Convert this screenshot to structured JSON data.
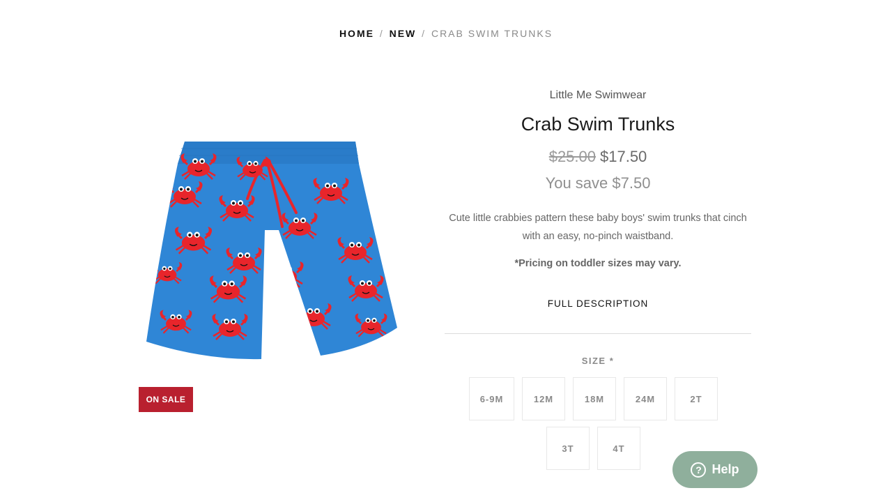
{
  "breadcrumb": {
    "home": "HOME",
    "new": "NEW",
    "current": "CRAB SWIM TRUNKS",
    "separator": "/"
  },
  "product": {
    "vendor": "Little Me Swimwear",
    "title": "Crab Swim Trunks",
    "compare_price": "$25.00",
    "price": "$17.50",
    "savings": "You save $7.50",
    "description": "Cute little crabbies pattern these baby boys' swim trunks that cinch with an easy, no-pinch waistband.",
    "note": "*Pricing on toddler sizes may vary.",
    "full_description_link": "FULL DESCRIPTION",
    "badge": "ON SALE"
  },
  "size": {
    "label": "SIZE *",
    "options": [
      "6-9M",
      "12M",
      "18M",
      "24M",
      "2T",
      "3T",
      "4T"
    ]
  },
  "help": {
    "label": "Help",
    "icon": "?"
  },
  "colors": {
    "sale_badge": "#b9202f",
    "help_button": "#8faf9c",
    "fabric_blue": "#2f86d6",
    "crab_red": "#e8252b"
  }
}
